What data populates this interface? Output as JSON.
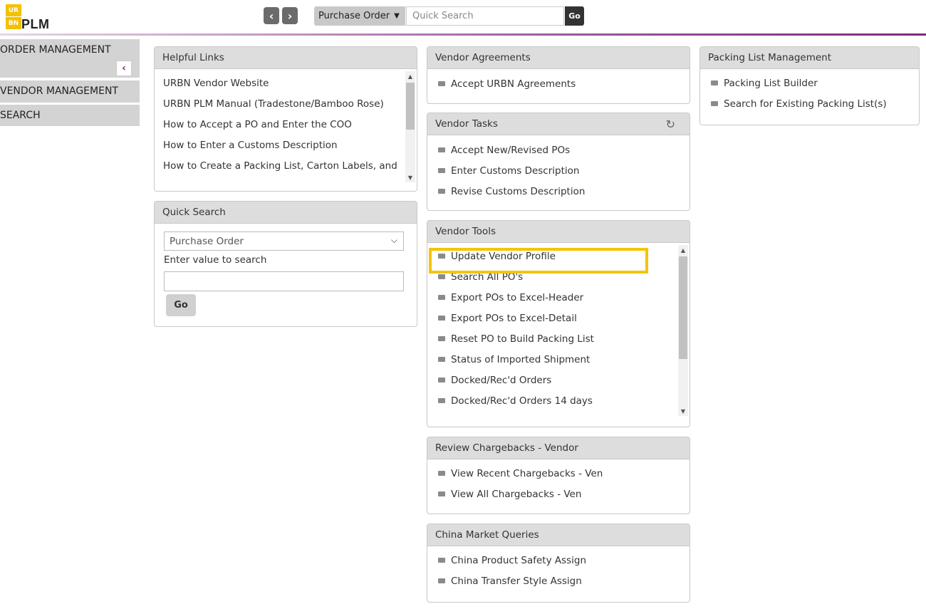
{
  "header": {
    "logo_top": "UR",
    "logo_bottom": "BN",
    "logo_text": "PLM",
    "back_icon": "chevron-left-icon",
    "forward_icon": "chevron-right-icon",
    "search_type": "Purchase Order",
    "search_placeholder": "Quick Search",
    "go_label": "Go",
    "accent_color": "#7a2b7e"
  },
  "sidebar": {
    "items": [
      {
        "label": "ORDER MANAGEMENT"
      },
      {
        "label": "VENDOR MANAGEMENT"
      },
      {
        "label": "SEARCH"
      }
    ]
  },
  "helpful_links": {
    "title": "Helpful Links",
    "items": [
      "URBN Vendor Website",
      "URBN PLM Manual (Tradestone/Bamboo Rose)",
      "How to Accept a PO and Enter the COO",
      "How to Enter a Customs Description",
      "How to Create a Packing List, Carton Labels, and"
    ]
  },
  "quick_search": {
    "title": "Quick Search",
    "selected": "Purchase Order",
    "prompt": "Enter value to search",
    "go_label": "Go"
  },
  "vendor_agreements": {
    "title": "Vendor Agreements",
    "items": [
      "Accept URBN Agreements"
    ]
  },
  "vendor_tasks": {
    "title": "Vendor Tasks",
    "items": [
      "Accept New/Revised POs",
      "Enter Customs Description",
      "Revise Customs Description"
    ]
  },
  "vendor_tools": {
    "title": "Vendor Tools",
    "highlight_color": "#f5c400",
    "items": [
      "Update Vendor Profile",
      "Search All PO's",
      "Export POs to Excel-Header",
      "Export POs to Excel-Detail",
      "Reset PO to Build Packing List",
      "Status of Imported Shipment",
      "Docked/Rec'd Orders",
      "Docked/Rec'd Orders 14 days"
    ]
  },
  "chargebacks": {
    "title": "Review Chargebacks - Vendor",
    "items": [
      "View Recent Chargebacks - Ven",
      "View All Chargebacks - Ven"
    ]
  },
  "china": {
    "title": "China Market Queries",
    "items": [
      "China Product Safety Assign",
      "China Transfer Style Assign"
    ]
  },
  "packing": {
    "title": "Packing List Management",
    "items": [
      "Packing List Builder",
      "Search for Existing Packing List(s)"
    ]
  }
}
